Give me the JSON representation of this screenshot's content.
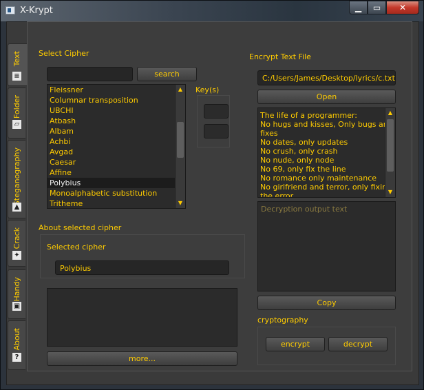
{
  "window": {
    "title": "X-Krypt",
    "minimize": "▁",
    "maximize": "▭",
    "close": "✕"
  },
  "tabs": [
    {
      "label": "Text",
      "icon": "text-icon"
    },
    {
      "label": "Folder",
      "icon": "folder-icon"
    },
    {
      "label": "Steganography",
      "icon": "image-icon"
    },
    {
      "label": "Crack",
      "icon": "crack-icon"
    },
    {
      "label": "Handy",
      "icon": "handy-icon"
    },
    {
      "label": "About",
      "icon": "about-icon"
    }
  ],
  "cipher": {
    "section_title": "Select Cipher",
    "search_value": "",
    "search_button": "search",
    "items": [
      "Fleissner",
      "Columnar transposition",
      "UBCHI",
      "Atbash",
      "Albam",
      "Achbi",
      "Avgad",
      "Caesar",
      "Affine",
      "Polybius",
      "Monoalphabetic substitution",
      "Tritheme"
    ],
    "selected_index": 9,
    "keys_label": "Key(s)"
  },
  "about": {
    "section_title": "About selected cipher",
    "selected_label": "Selected cipher",
    "selected_value": "Polybius",
    "description": "",
    "more_button": "more..."
  },
  "encrypt": {
    "section_title": "Encrypt Text File",
    "path": "C:/Users/James/Desktop/lyrics/c.txt",
    "open_button": "Open",
    "text_lines": [
      "The life of a programmer:",
      "No hugs and kisses, Only bugs and",
      "fixes",
      "No dates, only updates",
      "No crush, only crash",
      "No nude, only node",
      "No 69, only fix the line",
      "No romance only maintenance",
      "No girlfriend and terror, only fixing",
      "the error"
    ],
    "output_placeholder": "Decryption output text",
    "copy_button": "Copy",
    "crypto_label": "cryptography",
    "encrypt_button": "encrypt",
    "decrypt_button": "decrypt"
  }
}
